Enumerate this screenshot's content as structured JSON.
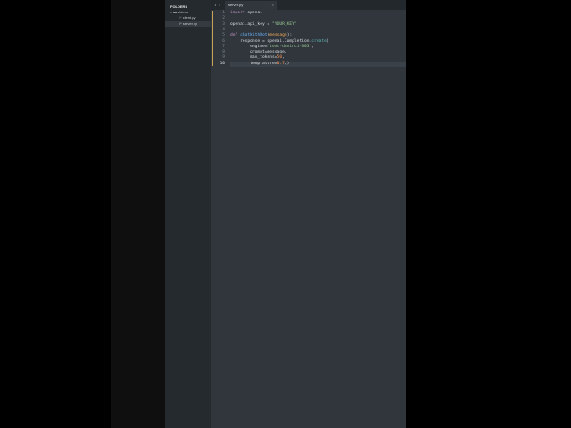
{
  "sidebar": {
    "header": "FOLDERS",
    "folder": "videos",
    "files": [
      "client.py",
      "server.py"
    ],
    "selected_file": "server.py"
  },
  "tabs": [
    {
      "label": "server.py",
      "close": "×"
    }
  ],
  "nav": "◂ ▸",
  "code": {
    "line_numbers": [
      "1",
      "2",
      "3",
      "4",
      "5",
      "6",
      "7",
      "8",
      "9",
      "10"
    ],
    "lines": [
      [
        {
          "t": "import",
          "c": "kw"
        },
        {
          "t": " openai"
        }
      ],
      [],
      [
        {
          "t": "openai.api_key = "
        },
        {
          "t": "\"YOUR_KEY\"",
          "c": "str"
        }
      ],
      [],
      [
        {
          "t": "def",
          "c": "kw"
        },
        {
          "t": " "
        },
        {
          "t": "chatWithBot",
          "c": "fn"
        },
        {
          "t": "("
        },
        {
          "t": "message",
          "c": "par"
        },
        {
          "t": "):"
        }
      ],
      [
        {
          "t": "    response = openai.Completion."
        },
        {
          "t": "create",
          "c": "mth"
        },
        {
          "t": "("
        }
      ],
      [
        {
          "t": "        engine="
        },
        {
          "t": "'text-davinci-003'",
          "c": "str"
        },
        {
          "t": ","
        }
      ],
      [
        {
          "t": "        prompt=message,"
        }
      ],
      [
        {
          "t": "        max_tokens="
        },
        {
          "t": "50",
          "c": "num"
        },
        {
          "t": ","
        }
      ],
      [
        {
          "t": "        temprature="
        },
        {
          "t": "0.7",
          "c": "num"
        },
        {
          "t": ",)"
        }
      ]
    ],
    "current_line": 10
  }
}
